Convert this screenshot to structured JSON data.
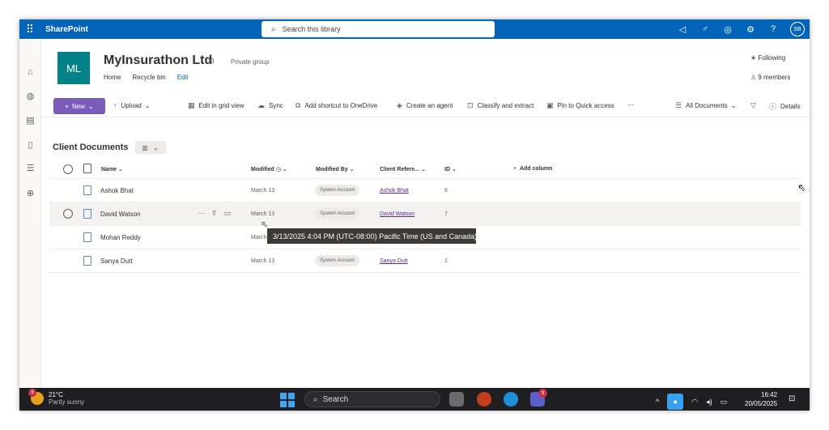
{
  "suitebar": {
    "app_name": "SharePoint",
    "search_placeholder": "Search this library",
    "avatar_initials": "SB"
  },
  "site": {
    "logo_initials": "ML",
    "title": "MyInsurathon Ltd",
    "group_type": "Private group",
    "nav": [
      "Home",
      "Recycle bin",
      "Edit"
    ],
    "following": "Following",
    "members": "9 members"
  },
  "commands": {
    "new": "New",
    "upload": "Upload",
    "grid": "Edit in grid view",
    "sync": "Sync",
    "shortcut": "Add shortcut to OneDrive",
    "agent": "Create an agent",
    "classify": "Classify and extract",
    "pin": "Pin to Quick access",
    "more": "···",
    "view": "All Documents",
    "details": "Details"
  },
  "library": {
    "title": "Client Documents",
    "columns": {
      "name": "Name",
      "modified": "Modified",
      "modified_by": "Modified By",
      "client_ref": "Client Refere...",
      "id": "ID",
      "add": "Add column"
    },
    "rows": [
      {
        "name": "Ashok Bhat",
        "modified": "March 13",
        "modified_by": "System Account",
        "client_ref": "Ashok Bhat",
        "id": "6"
      },
      {
        "name": "David Watson",
        "modified": "March 13",
        "modified_by": "System Account",
        "client_ref": "David Watson",
        "id": "7"
      },
      {
        "name": "Mohan Reddy",
        "modified": "March",
        "modified_by": "",
        "client_ref": "",
        "id": ""
      },
      {
        "name": "Sanya Dutt",
        "modified": "March 13",
        "modified_by": "System Account",
        "client_ref": "Sanya Dutt",
        "id": "2"
      }
    ]
  },
  "tooltip": "3/13/2025 4:04 PM (UTC-08:00) Pacific Time (US and Canada)",
  "taskbar": {
    "temp": "21°C",
    "condition": "Partly sunny",
    "weather_badge": "9",
    "search": "Search",
    "teams_badge": "9",
    "time": "16:42",
    "date": "20/05/2025"
  }
}
